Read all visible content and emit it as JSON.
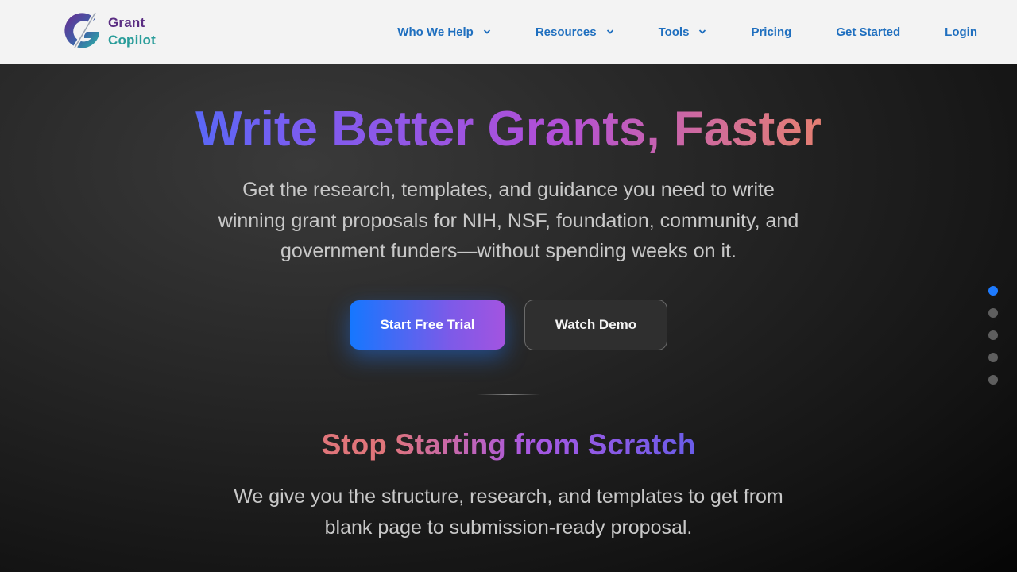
{
  "brand": {
    "name_line1": "Grant",
    "name_line2": "Copilot",
    "logo_icon": "g-slash-logo"
  },
  "nav": {
    "items": [
      {
        "label": "Who We Help",
        "has_dropdown": true
      },
      {
        "label": "Resources",
        "has_dropdown": true
      },
      {
        "label": "Tools",
        "has_dropdown": true
      },
      {
        "label": "Pricing",
        "has_dropdown": false
      },
      {
        "label": "Get Started",
        "has_dropdown": false
      },
      {
        "label": "Login",
        "has_dropdown": false
      }
    ]
  },
  "hero": {
    "headline": "Write Better Grants, Faster",
    "subtext": "Get the research, templates, and guidance you need to write winning grant proposals for NIH, NSF, foundation, community, and government funders—without spending weeks on it.",
    "primary_cta": "Start Free Trial",
    "secondary_cta": "Watch Demo"
  },
  "section": {
    "title": "Stop Starting from Scratch",
    "text": "We give you the structure, research, and templates to get from blank page to submission-ready proposal."
  },
  "pager": {
    "count": 5,
    "active_index": 0
  },
  "colors": {
    "nav_link": "#1f6fbf",
    "accent_blue": "#1e7bff",
    "accent_purple": "#a354e0",
    "accent_orange": "#f5913a"
  }
}
